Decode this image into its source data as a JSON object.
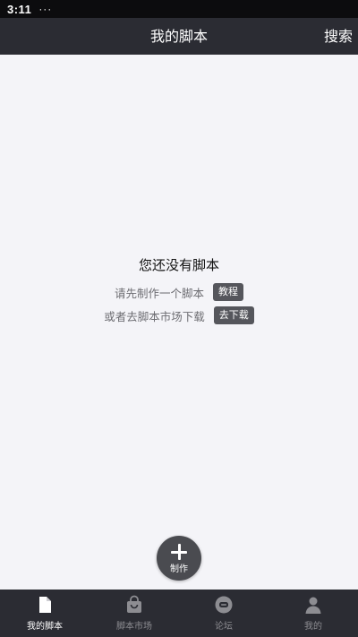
{
  "status_bar": {
    "time": "3:11",
    "dots": "···"
  },
  "header": {
    "title": "我的脚本",
    "search_label": "搜索"
  },
  "empty_state": {
    "title": "您还没有脚本",
    "line1_text": "请先制作一个脚本",
    "line1_button": "教程",
    "line2_text": "或者去脚本市场下载",
    "line2_button": "去下载"
  },
  "fab": {
    "label": "制作",
    "icon": "plus-icon"
  },
  "bottom_nav": {
    "items": [
      {
        "label": "我的脚本",
        "icon": "document-icon",
        "active": true
      },
      {
        "label": "脚本市场",
        "icon": "shopping-bag-icon",
        "active": false
      },
      {
        "label": "论坛",
        "icon": "chat-bubble-icon",
        "active": false
      },
      {
        "label": "我的",
        "icon": "person-icon",
        "active": false
      }
    ]
  },
  "colors": {
    "header_bg": "#2b2c33",
    "nav_bg": "#2b2c33",
    "page_bg": "#f4f4f8",
    "pill_bg": "#55565c",
    "fab_bg": "#4a4b50",
    "nav_inactive": "#8d8d92",
    "nav_active": "#ffffff"
  }
}
